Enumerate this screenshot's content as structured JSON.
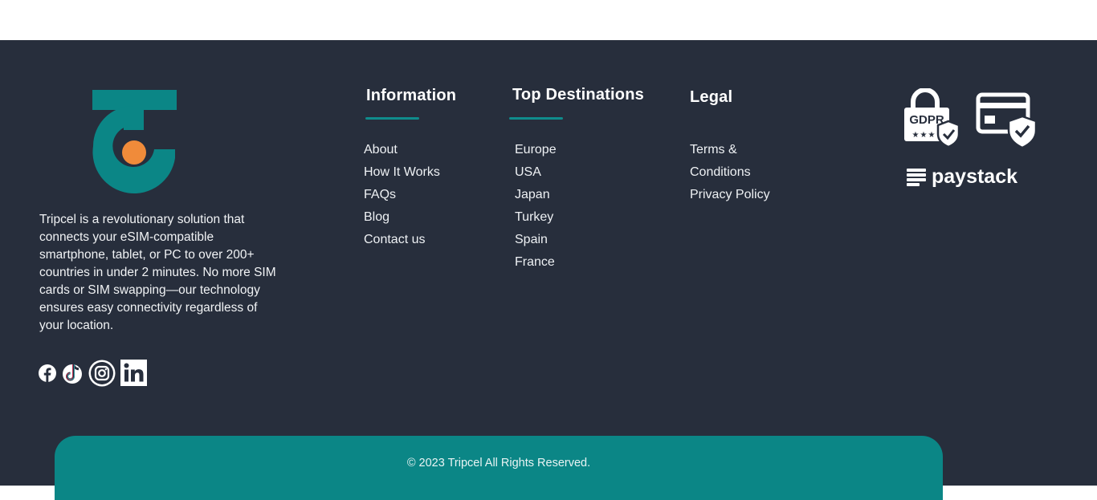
{
  "about": {
    "text": "Tripcel is a revolutionary solution that connects your eSIM-compatible smartphone, tablet, or PC to over 200+ countries in under 2 minutes. No more SIM cards or SIM swapping—our technology ensures easy connectivity regardless of your location."
  },
  "social": [
    "facebook-icon",
    "tiktok-icon",
    "instagram-icon",
    "linkedin-icon"
  ],
  "information": {
    "title": "Information",
    "links": [
      "About",
      "How It Works",
      "FAQs",
      "Blog",
      "Contact us"
    ]
  },
  "destinations": {
    "title": "Top Destinations",
    "links": [
      "Europe",
      "USA",
      "Japan",
      "Turkey",
      "Spain",
      "France"
    ]
  },
  "legal": {
    "title": "Legal",
    "links": [
      "Terms &",
      "Conditions",
      "Privacy Policy"
    ]
  },
  "badges": {
    "gdpr_label": "GDPR",
    "paystack_label": "paystack"
  },
  "copyright": "© 2023 Tripcel All Rights Reserved.",
  "colors": {
    "footer_bg": "#272e3c",
    "teal": "#0b8686",
    "orange": "#f08b3a"
  }
}
